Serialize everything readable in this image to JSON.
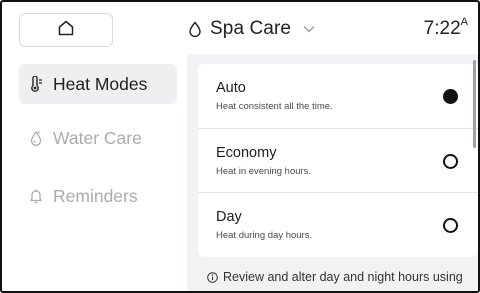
{
  "header": {
    "title": "Spa Care",
    "time": "7:22",
    "time_suffix": "A",
    "icons": {
      "home": "home-icon",
      "title": "water-drop-icon",
      "dropdown": "chevron-down-icon"
    }
  },
  "sidebar": {
    "items": [
      {
        "label": "Heat Modes",
        "icon": "thermometer-icon",
        "active": true
      },
      {
        "label": "Water Care",
        "icon": "water-care-icon",
        "active": false
      },
      {
        "label": "Reminders",
        "icon": "bell-icon",
        "active": false
      }
    ]
  },
  "modes": {
    "options": [
      {
        "name": "Auto",
        "description": "Heat consistent all the time.",
        "selected": true
      },
      {
        "name": "Economy",
        "description": "Heat in evening hours.",
        "selected": false
      },
      {
        "name": "Day",
        "description": "Heat during day hours.",
        "selected": false
      }
    ]
  },
  "info_text": "Review and alter day and night hours using",
  "colors": {
    "accent": "#111111",
    "active_item_bg": "#eeeff1",
    "inactive_text": "#a8abb0",
    "panel_bg": "#f1f2f4"
  }
}
